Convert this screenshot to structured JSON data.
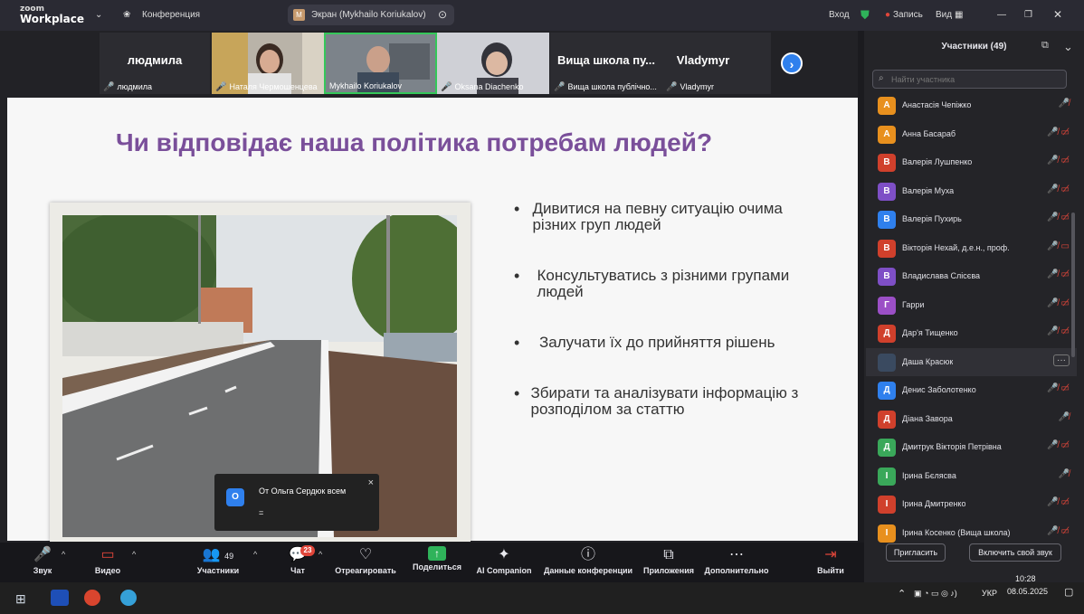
{
  "titlebar": {
    "brand_top": "zoom",
    "brand_bottom": "Workplace",
    "meeting_menu": "Конференция",
    "screen_pill": "Экран (Mykhailo Koriukalov)",
    "screen_pill_badge": "M",
    "sign_in": "Вход",
    "record": "Запись",
    "view": "Вид"
  },
  "strip": {
    "tiles": [
      {
        "big": "людмила",
        "label": "людмила"
      },
      {
        "big": "",
        "label": "Наталя Чермошенцева"
      },
      {
        "big": "",
        "label": "Mykhailo Koriukalov"
      },
      {
        "big": "",
        "label": "Oksana Diachenko"
      },
      {
        "big": "Вища школа пу...",
        "label": "Вища школа публічно..."
      },
      {
        "big": "Vladymyr",
        "label": "Vladymyr"
      }
    ]
  },
  "slide": {
    "title": "Чи відповідає наша політика потребам людей?",
    "bullets": [
      "Дивитися на певну ситуацію очима різних груп людей",
      "Консультуватись з різними групами людей",
      "Залучати їх до прийняття рішень",
      "Збирати та аналізувати інформацію з розподілом за статтю"
    ],
    "bullet_char": "•"
  },
  "notification": {
    "avatar": "О",
    "from": "От Ольга Сердюк всем",
    "message": "=",
    "close": "×"
  },
  "toolbar": {
    "audio": "Звук",
    "video": "Видео",
    "participants": "Участники",
    "participants_count": "49",
    "chat": "Чат",
    "chat_badge": "23",
    "react": "Отреагировать",
    "share": "Поделиться",
    "ai": "AI Companion",
    "info": "Данные конференции",
    "apps": "Приложения",
    "more": "Дополнительно",
    "leave": "Выйти"
  },
  "panel": {
    "title": "Участники (49)",
    "search_placeholder": "Найти участника",
    "participants": [
      {
        "initial": "А",
        "name": "Анастасія Чепіжко",
        "color": "#e8901e",
        "icons": "🎤̸"
      },
      {
        "initial": "А",
        "name": "Анна Басараб",
        "color": "#e8901e",
        "icons": "🎤̸ ▭̸"
      },
      {
        "initial": "В",
        "name": "Валерія Лушпенко",
        "color": "#d0402c",
        "icons": "🎤̸ ▭̸"
      },
      {
        "initial": "В",
        "name": "Валерія Муха",
        "color": "#7e4fc6",
        "icons": "🎤̸ ▭̸"
      },
      {
        "initial": "В",
        "name": "Валерія Пухирь",
        "color": "#2f80ed",
        "icons": "🎤̸ ▭̸"
      },
      {
        "initial": "В",
        "name": "Вікторія Нехай, д.е.н., проф.",
        "color": "#d0402c",
        "icons": "🎤̸ ▭"
      },
      {
        "initial": "В",
        "name": "Владислава Слісєва",
        "color": "#7e4fc6",
        "icons": "🎤̸ ▭̸"
      },
      {
        "initial": "Г",
        "name": "Гарри",
        "color": "#9b4fc6",
        "icons": "🎤̸ ▭̸"
      },
      {
        "initial": "Д",
        "name": "Дар'я Тищенко",
        "color": "#d0402c",
        "icons": "🎤̸ ▭̸"
      },
      {
        "initial": "",
        "name": "Даша Красюк",
        "color": "#3a4a60",
        "icons": "···"
      },
      {
        "initial": "Д",
        "name": "Денис Заболотенко",
        "color": "#2f80ed",
        "icons": "🎤̸ ▭̸"
      },
      {
        "initial": "Д",
        "name": "Діана Завора",
        "color": "#d0402c",
        "icons": "🎤̸"
      },
      {
        "initial": "Д",
        "name": "Дмитрук Вікторія Петрівна",
        "color": "#3aa85a",
        "icons": "🎤̸ ▭̸"
      },
      {
        "initial": "І",
        "name": "Ірина Бєлясва",
        "color": "#3aa85a",
        "icons": "🎤̸"
      },
      {
        "initial": "І",
        "name": "Ірина Дмитренко",
        "color": "#d0402c",
        "icons": "🎤̸ ▭̸"
      },
      {
        "initial": "І",
        "name": "Ірина Косенко (Вища школа)",
        "color": "#e8901e",
        "icons": "🎤̸ ▭̸"
      }
    ],
    "invite": "Пригласить",
    "unmute": "Включить свой звук"
  },
  "taskbar": {
    "lang": "УКР",
    "time": "10:28",
    "date": "08.05.2025"
  },
  "colors": {
    "accent": "#2f80ed",
    "mic_muted": "#e0463a",
    "slide_title": "#7a4f9a"
  }
}
